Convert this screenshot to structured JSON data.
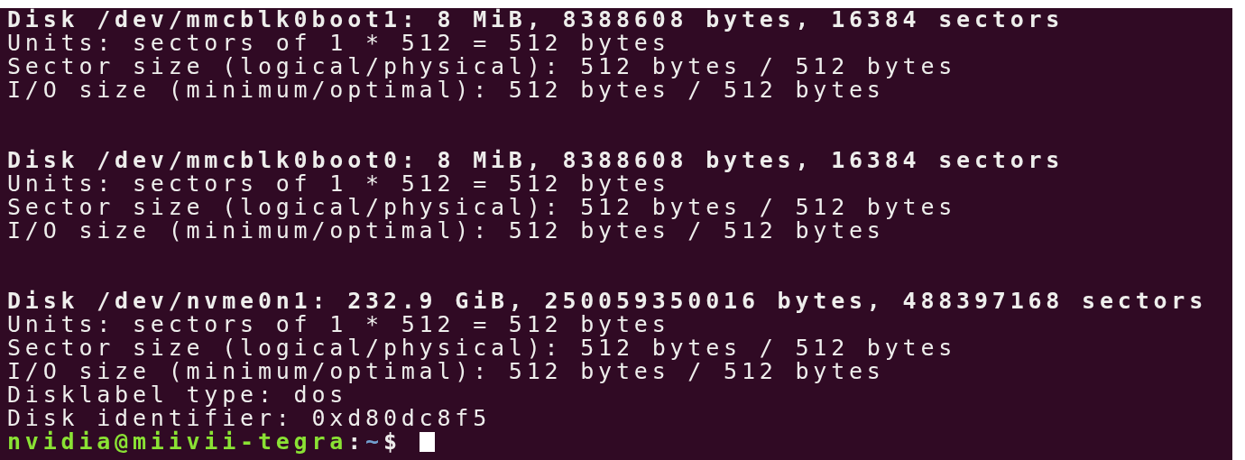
{
  "terminal": {
    "blocks": [
      {
        "header": "Disk /dev/mmcblk0boot1: 8 MiB, 8388608 bytes, 16384 sectors",
        "lines": [
          "Units: sectors of 1 * 512 = 512 bytes",
          "Sector size (logical/physical): 512 bytes / 512 bytes",
          "I/O size (minimum/optimal): 512 bytes / 512 bytes"
        ]
      },
      {
        "header": "Disk /dev/mmcblk0boot0: 8 MiB, 8388608 bytes, 16384 sectors",
        "lines": [
          "Units: sectors of 1 * 512 = 512 bytes",
          "Sector size (logical/physical): 512 bytes / 512 bytes",
          "I/O size (minimum/optimal): 512 bytes / 512 bytes"
        ]
      },
      {
        "header": "Disk /dev/nvme0n1: 232.9 GiB, 250059350016 bytes, 488397168 sectors",
        "lines": [
          "Units: sectors of 1 * 512 = 512 bytes",
          "Sector size (logical/physical): 512 bytes / 512 bytes",
          "I/O size (minimum/optimal): 512 bytes / 512 bytes",
          "Disklabel type: dos",
          "Disk identifier: 0xd80dc8f5"
        ]
      }
    ],
    "prompt": {
      "user_host": "nvidia@miivii-tegra",
      "separator": ":",
      "path": "~",
      "symbol": "$"
    }
  }
}
